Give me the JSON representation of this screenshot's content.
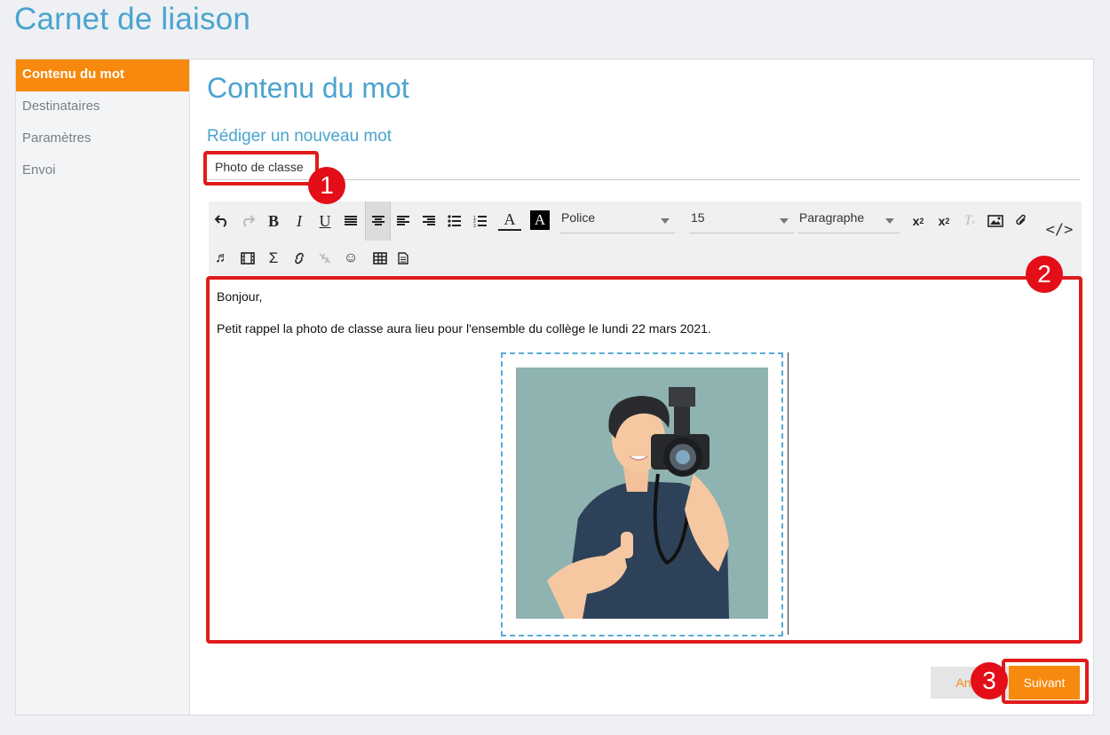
{
  "header": {
    "title": "Carnet de liaison"
  },
  "sidebar": {
    "items": [
      {
        "label": "Contenu du mot",
        "active": true
      },
      {
        "label": "Destinataires"
      },
      {
        "label": "Paramètres"
      },
      {
        "label": "Envoi"
      }
    ]
  },
  "main": {
    "title": "Contenu du mot",
    "subtitle": "Rédiger un nouveau mot",
    "subject_value": "Photo de classe"
  },
  "toolbar": {
    "font_label": "Police",
    "size_label": "15",
    "format_label": "Paragraphe",
    "code_label": "</>",
    "icons_row1": [
      "undo-icon",
      "redo-icon",
      "bold-icon",
      "italic-icon",
      "underline-icon",
      "align-justify-icon",
      "align-center-icon",
      "align-left-icon",
      "align-right-icon",
      "bullet-list-icon",
      "numbered-list-icon",
      "font-color-icon",
      "background-color-icon"
    ],
    "icons_row1_right": [
      "subscript-icon",
      "superscript-icon",
      "clear-format-icon",
      "image-icon",
      "attachment-icon"
    ],
    "icons_row2": [
      "audio-icon",
      "video-icon",
      "sigma-icon",
      "link-icon",
      "unlink-icon",
      "emoji-icon",
      "table-icon",
      "template-icon"
    ]
  },
  "content": {
    "line1": "Bonjour,",
    "line2": "Petit rappel la photo de classe aura lieu pour l'ensemble du collège le lundi 22 mars 2021."
  },
  "actions": {
    "cancel_label": "Annuler",
    "next_label": "Suivant"
  },
  "annotations": {
    "step1": "1",
    "step2": "2",
    "step3": "3"
  },
  "colors": {
    "accent_orange": "#f7890e",
    "title_blue": "#4aa3cf",
    "highlight_red": "#e01b1b",
    "photo_bg": "#8fb3b0"
  }
}
